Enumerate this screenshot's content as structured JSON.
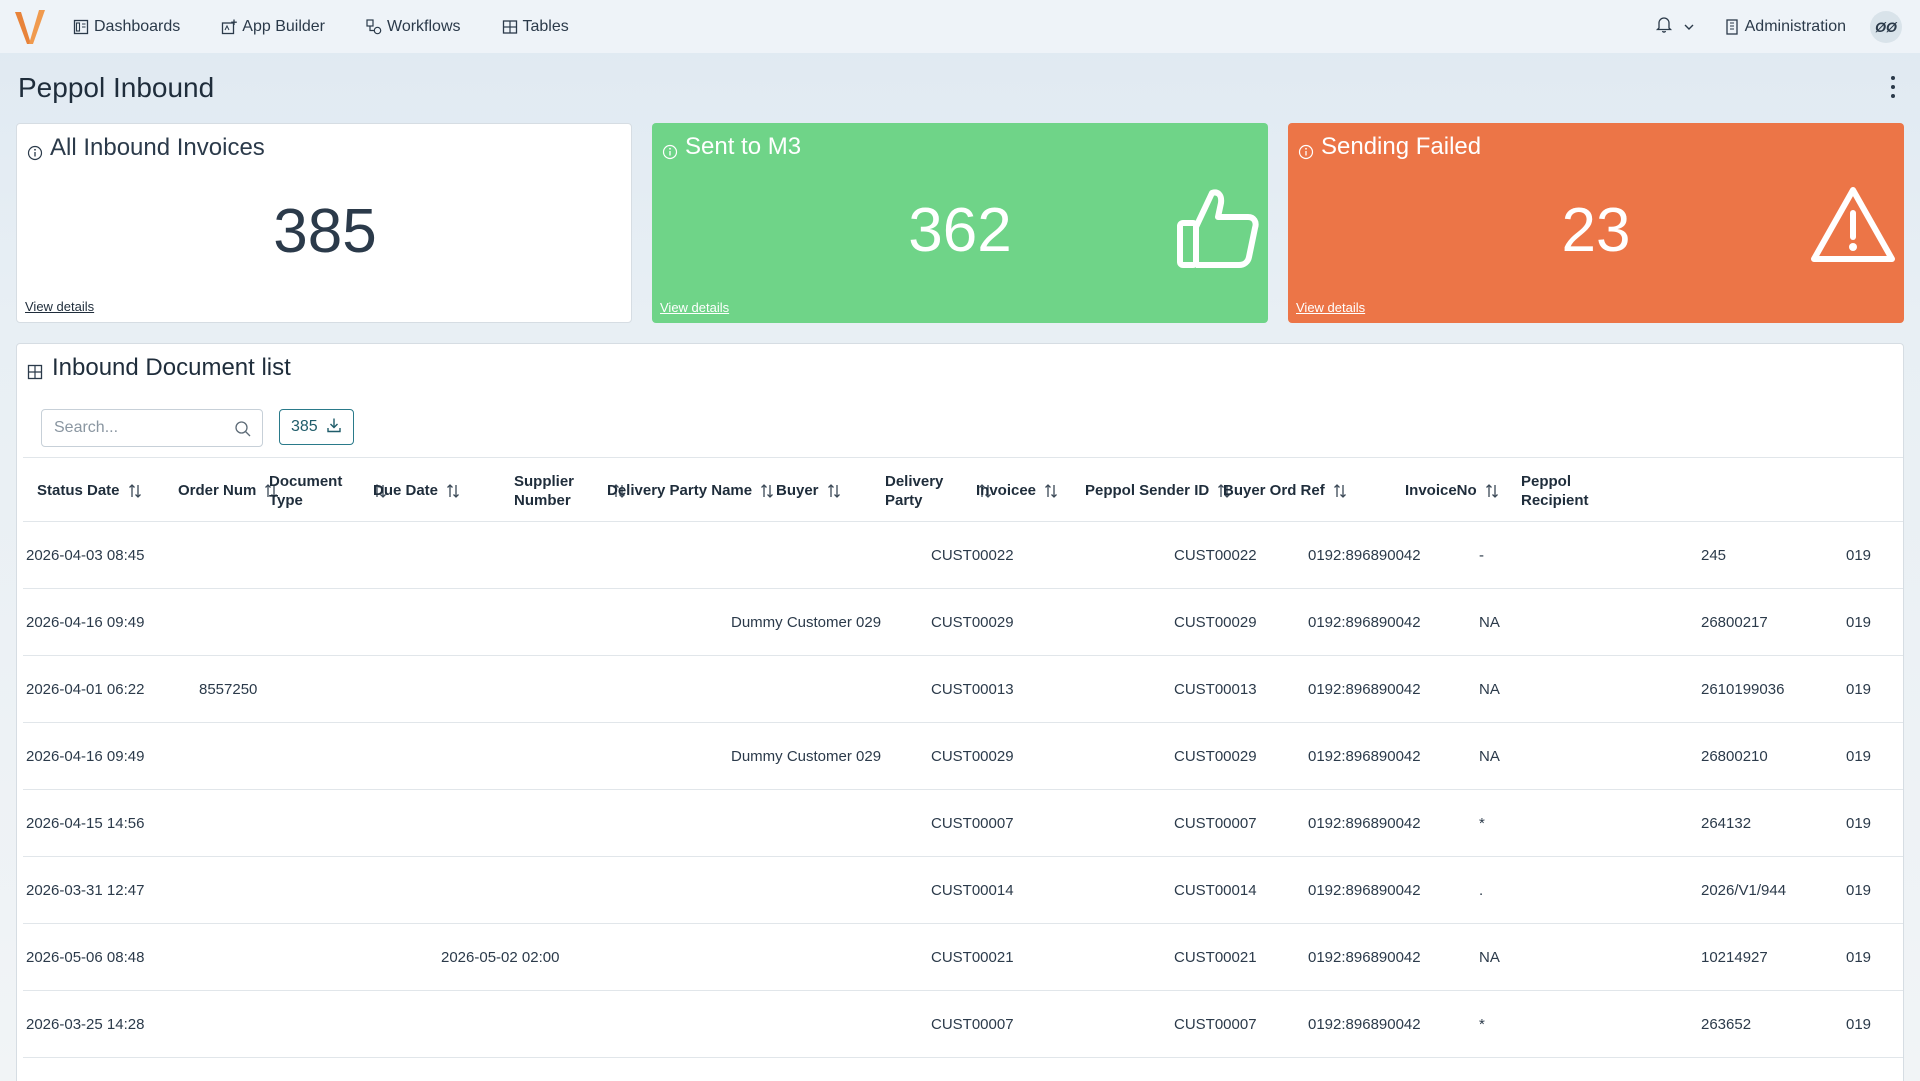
{
  "nav": {
    "items": [
      {
        "label": "Dashboards",
        "icon": "dashboard-icon"
      },
      {
        "label": "App Builder",
        "icon": "app-builder-icon"
      },
      {
        "label": "Workflows",
        "icon": "workflow-icon"
      },
      {
        "label": "Tables",
        "icon": "table-icon"
      }
    ],
    "admin_label": "Administration",
    "avatar_initials": "ØØ"
  },
  "page": {
    "title": "Peppol Inbound"
  },
  "cards": [
    {
      "title": "All Inbound Invoices",
      "value": "385",
      "link": "View details",
      "color": "#ffffff"
    },
    {
      "title": "Sent to M3",
      "value": "362",
      "link": "View details",
      "color": "#6fd488",
      "icon": "thumbs-up-icon"
    },
    {
      "title": "Sending Failed",
      "value": "23",
      "link": "View details",
      "color": "#ec7547",
      "icon": "warning-icon"
    }
  ],
  "document_list": {
    "title": "Inbound Document list",
    "search_placeholder": "Search...",
    "export_count": "385",
    "columns": [
      "Status Date",
      "Order Num",
      "Document Type",
      "Due Date",
      "Supplier Number",
      "Delivery Party Name",
      "Buyer",
      "Delivery Party",
      "Invoicee",
      "Peppol Sender ID",
      "Buyer Ord Ref",
      "InvoiceNo",
      "Peppol Recipient"
    ],
    "rows": [
      {
        "status_date": "2026-04-03 08:45",
        "order_num": "",
        "due_date": "",
        "delivery_party_name": "",
        "buyer": "CUST00022",
        "invoicee": "CUST00022",
        "sender_id": "0192:896890042",
        "buyer_ord_ref": "-",
        "invoice_no": "245",
        "recipient": "019"
      },
      {
        "status_date": "2026-04-16 09:49",
        "order_num": "",
        "due_date": "",
        "delivery_party_name": "Dummy Customer 029",
        "buyer": "CUST00029",
        "invoicee": "CUST00029",
        "sender_id": "0192:896890042",
        "buyer_ord_ref": "NA",
        "invoice_no": "26800217",
        "recipient": "019"
      },
      {
        "status_date": "2026-04-01 06:22",
        "order_num": "8557250",
        "due_date": "",
        "delivery_party_name": "",
        "buyer": "CUST00013",
        "invoicee": "CUST00013",
        "sender_id": "0192:896890042",
        "buyer_ord_ref": "NA",
        "invoice_no": "2610199036",
        "recipient": "019"
      },
      {
        "status_date": "2026-04-16 09:49",
        "order_num": "",
        "due_date": "",
        "delivery_party_name": "Dummy Customer 029",
        "buyer": "CUST00029",
        "invoicee": "CUST00029",
        "sender_id": "0192:896890042",
        "buyer_ord_ref": "NA",
        "invoice_no": "26800210",
        "recipient": "019"
      },
      {
        "status_date": "2026-04-15 14:56",
        "order_num": "",
        "due_date": "",
        "delivery_party_name": "",
        "buyer": "CUST00007",
        "invoicee": "CUST00007",
        "sender_id": "0192:896890042",
        "buyer_ord_ref": "*",
        "invoice_no": "264132",
        "recipient": "019"
      },
      {
        "status_date": "2026-03-31 12:47",
        "order_num": "",
        "due_date": "",
        "delivery_party_name": "",
        "buyer": "CUST00014",
        "invoicee": "CUST00014",
        "sender_id": "0192:896890042",
        "buyer_ord_ref": ".",
        "invoice_no": "2026/V1/944",
        "recipient": "019"
      },
      {
        "status_date": "2026-05-06 08:48",
        "order_num": "",
        "due_date": "2026-05-02 02:00",
        "delivery_party_name": "",
        "buyer": "CUST00021",
        "invoicee": "CUST00021",
        "sender_id": "0192:896890042",
        "buyer_ord_ref": "NA",
        "invoice_no": "10214927",
        "recipient": "019"
      },
      {
        "status_date": "2026-03-25 14:28",
        "order_num": "",
        "due_date": "",
        "delivery_party_name": "",
        "buyer": "CUST00007",
        "invoicee": "CUST00007",
        "sender_id": "0192:896890042",
        "buyer_ord_ref": "*",
        "invoice_no": "263652",
        "recipient": "019"
      }
    ]
  }
}
